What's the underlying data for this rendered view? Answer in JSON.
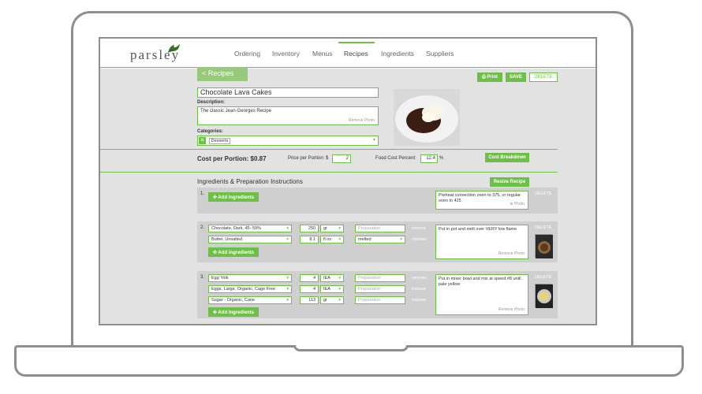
{
  "app": {
    "logo_text": "parsley",
    "nav": [
      "Ordering",
      "Inventory",
      "Menus",
      "Recipes",
      "Ingredients",
      "Suppliers"
    ],
    "active_nav": "Recipes"
  },
  "toolbar": {
    "back_label": "< Recipes",
    "print_label": "Print",
    "save_label": "SAVE",
    "delete_label": "DELETE"
  },
  "recipe": {
    "name": "Chocolate Lava Cakes",
    "description_label": "Description:",
    "description": "The classic Jean-Georges Recipe",
    "remove_photo": "Remove Photo",
    "categories_label": "Categories:",
    "category": "Desserts"
  },
  "costs": {
    "cost_per_portion": "Cost per Portion: $0.87",
    "price_label": "Price per Portion: $",
    "price_value": "2",
    "food_cost_label": "Food Cost Percent:",
    "food_cost_value": "12.4",
    "food_cost_unit": "%",
    "breakdown_label": "Cost Breakdown"
  },
  "section": {
    "title": "Ingredients & Preparation Instructions",
    "resize_label": "Resize Recipe"
  },
  "common": {
    "add_label": "Add Ingredients",
    "remove": "remove",
    "delete": "DELETE",
    "prep_placeholder": "Preparation",
    "remove_photo": "Remove Photo",
    "photo": "Photo"
  },
  "steps": [
    {
      "num": "1.",
      "note": "Preheat convection oven to 375, or regular oven to 425",
      "ingredients": []
    },
    {
      "num": "2.",
      "note": "Put in pot and melt over VERY low flame",
      "ingredients": [
        {
          "name": "Chocolate, Dark, 45- 59%",
          "qty": "250",
          "unit": "gr",
          "prep": ""
        },
        {
          "name": "Butter, Unsalted",
          "qty": "8.1",
          "unit": "fl oz",
          "prep": "melted"
        }
      ]
    },
    {
      "num": "3.",
      "note": "Put in mixer bowl and mix at speed #8 until pale yellow",
      "ingredients": [
        {
          "name": "Egg Yolk",
          "qty": "4",
          "unit": "IEA",
          "prep": ""
        },
        {
          "name": "Eggs, Large, Organic, Cage Free",
          "qty": "4",
          "unit": "IEA",
          "prep": ""
        },
        {
          "name": "Sugar - Organic, Cane",
          "qty": "113",
          "unit": "gr",
          "prep": ""
        }
      ]
    }
  ],
  "colors": {
    "accent": "#6dbf47",
    "panel": "#e2e2e2",
    "step": "#cfcfcf"
  }
}
